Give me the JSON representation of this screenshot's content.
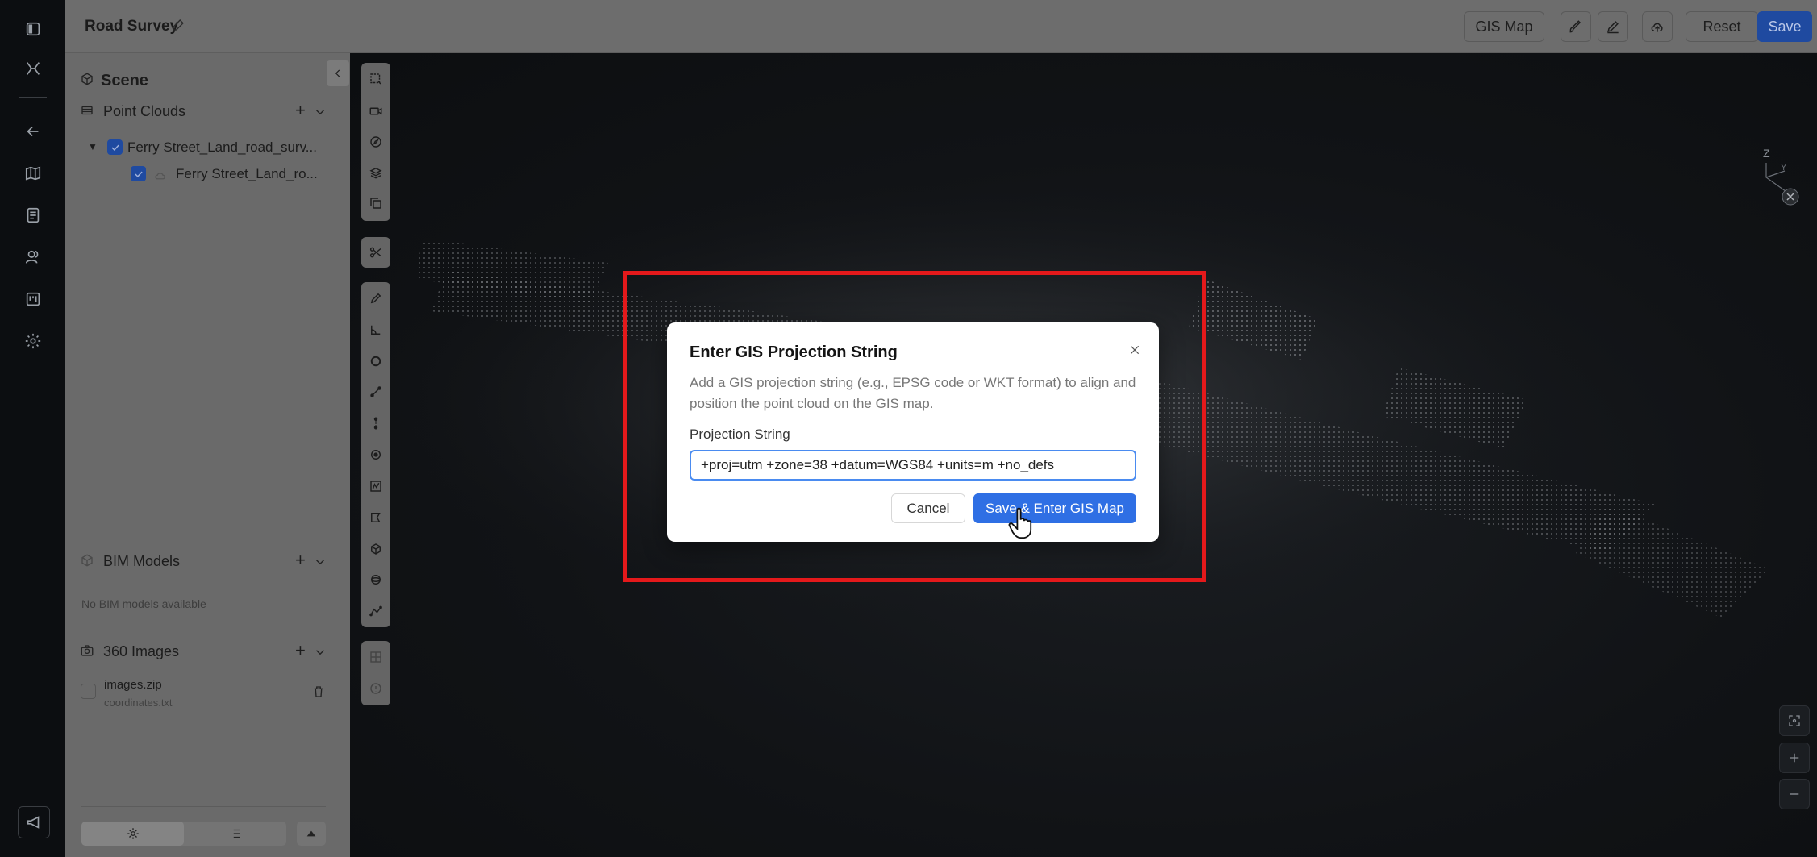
{
  "header": {
    "project_title": "Road Survey",
    "gis_map_button": "GIS Map",
    "reset_button": "Reset",
    "save_button": "Save"
  },
  "sidebar": {
    "scene_title": "Scene",
    "point_clouds_label": "Point Clouds",
    "tree": [
      {
        "label": "Ferry Street_Land_road_surv...",
        "checked": true
      },
      {
        "label": "Ferry Street_Land_ro...",
        "checked": true
      }
    ],
    "bim_models_label": "BIM Models",
    "bim_empty": "No BIM models available",
    "images_label": "360 Images",
    "image_file": "images.zip",
    "image_coords": "coordinates.txt"
  },
  "viewport": {
    "axis_z": "Z",
    "axis_y": "Y"
  },
  "dialog": {
    "title": "Enter GIS Projection String",
    "description": "Add a GIS projection string (e.g., EPSG code or WKT format) to align and position the point cloud on the GIS map.",
    "field_label": "Projection String",
    "field_value": "+proj=utm +zone=38 +datum=WGS84 +units=m +no_defs",
    "cancel_label": "Cancel",
    "confirm_label": "Save & Enter GIS Map"
  },
  "colors": {
    "accent": "#2f6fe4",
    "highlight": "#e4191b",
    "overlay": "#6d6d6d"
  }
}
